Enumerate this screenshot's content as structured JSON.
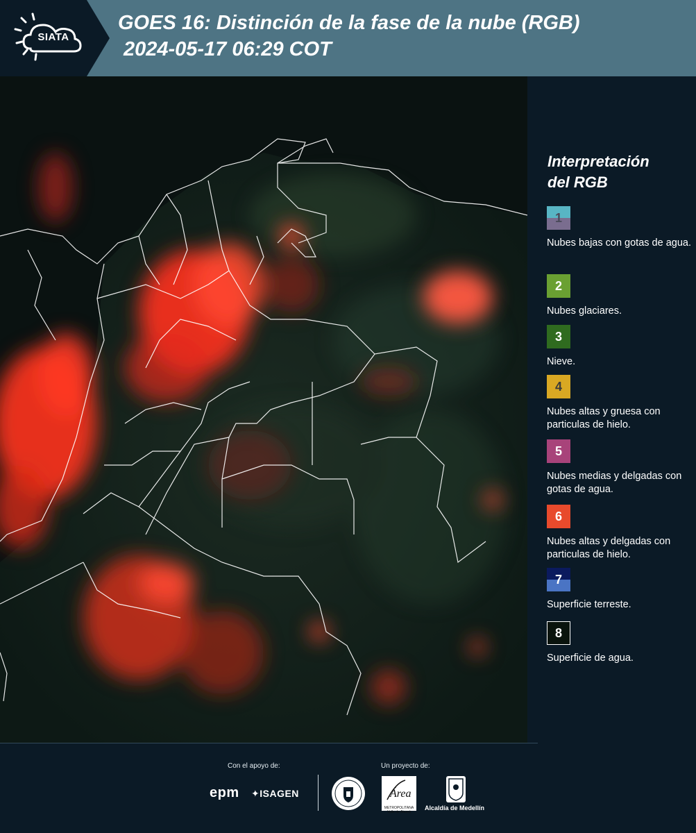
{
  "header": {
    "logo_text": "SIATA",
    "title_line1": "GOES 16: Distinción de la fase de la nube (RGB)",
    "title_line2": "2024-05-17 06:29 COT",
    "background_color": "#4e7484"
  },
  "map": {
    "description_icon": "satellite-map",
    "land_color": "#0d1d18",
    "cloud_color": "#ff3a22",
    "border_color": "#ffffff"
  },
  "legend": {
    "title_line1": "Interpretación",
    "title_line2": "del RGB",
    "items": [
      {
        "number": "1",
        "label": "Nubes bajas con gotas de agua.",
        "color_top": "#58b5c4",
        "color_bottom": "#7a6d8f"
      },
      {
        "number": "2",
        "label": "Nubes glaciares.",
        "color_top": "#6aa032",
        "color_bottom": "#6aa032"
      },
      {
        "number": "3",
        "label": "Nieve.",
        "color_top": "#2f6b1f",
        "color_bottom": "#2f6b1f"
      },
      {
        "number": "4",
        "label": "Nubes altas y gruesa con particulas de hielo.",
        "color_top": "#d9a823",
        "color_bottom": "#d9a823"
      },
      {
        "number": "5",
        "label": "Nubes medias y delgadas con gotas de agua.",
        "color_top": "#a8437a",
        "color_bottom": "#a8437a"
      },
      {
        "number": "6",
        "label": "Nubes altas y delgadas con particulas de hielo.",
        "color_top": "#e84a2c",
        "color_bottom": "#e84a2c"
      },
      {
        "number": "7",
        "label": "Superficie terreste.",
        "color_top": "#0b1a5e",
        "color_bottom": "#4a74c4"
      },
      {
        "number": "8",
        "label": "Superficie de agua.",
        "color_top": "#0a130d",
        "color_bottom": "#0a130d"
      }
    ]
  },
  "footer": {
    "support_label": "Con el apoyo de:",
    "project_label": "Un proyecto de:",
    "epm_text": "epm",
    "isagen_text": "ISAGEN",
    "amva_text": "Área",
    "amva_sub": "METROPOLITANA Valle de Aburrá",
    "alcaldia_text": "Alcaldía de Medellín"
  }
}
